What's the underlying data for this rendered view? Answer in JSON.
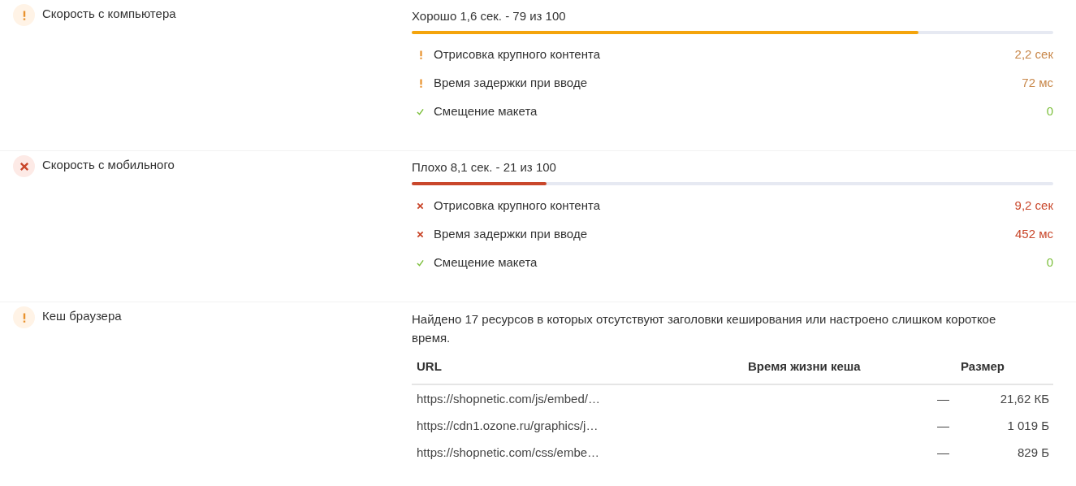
{
  "sections": [
    {
      "title": "Скорость с компьютера",
      "kind": "warn",
      "summary": "Хорошо 1,6 сек. - 79 из 100",
      "level": 0.79,
      "metrics": [
        {
          "label": "Отрисовка крупного контента",
          "value": "2,2 сек",
          "kind": "warn"
        },
        {
          "label": "Время задержки при вводе",
          "value": "72 мс",
          "kind": "warn"
        },
        {
          "label": "Смещение макета",
          "value": "0",
          "kind": "pass"
        }
      ]
    },
    {
      "title": "Скорость с мобильного",
      "kind": "fail",
      "summary": "Плохо 8,1 сек. - 21 из 100",
      "level": 0.21,
      "metrics": [
        {
          "label": "Отрисовка крупного контента",
          "value": "9,2 сек",
          "kind": "fail"
        },
        {
          "label": "Время задержки при вводе",
          "value": "452 мс",
          "kind": "fail"
        },
        {
          "label": "Смещение макета",
          "value": "0",
          "kind": "pass"
        }
      ]
    },
    {
      "title": "Кеш браузера",
      "kind": "warn",
      "description": "Найдено 17 ресурсов в которых отсутствуют заголовки кеширования или настроено слишком короткое время.",
      "table": {
        "columns": [
          "URL",
          "Время жизни кеша",
          "Размер"
        ],
        "rows": [
          [
            "https://shopnetic.com/js/embed/…",
            "—",
            "21,62 КБ"
          ],
          [
            "https://cdn1.ozone.ru/graphics/j…",
            "—",
            "1 019 Б"
          ],
          [
            "https://shopnetic.com/css/embe…",
            "—",
            "829 Б"
          ]
        ]
      }
    }
  ]
}
